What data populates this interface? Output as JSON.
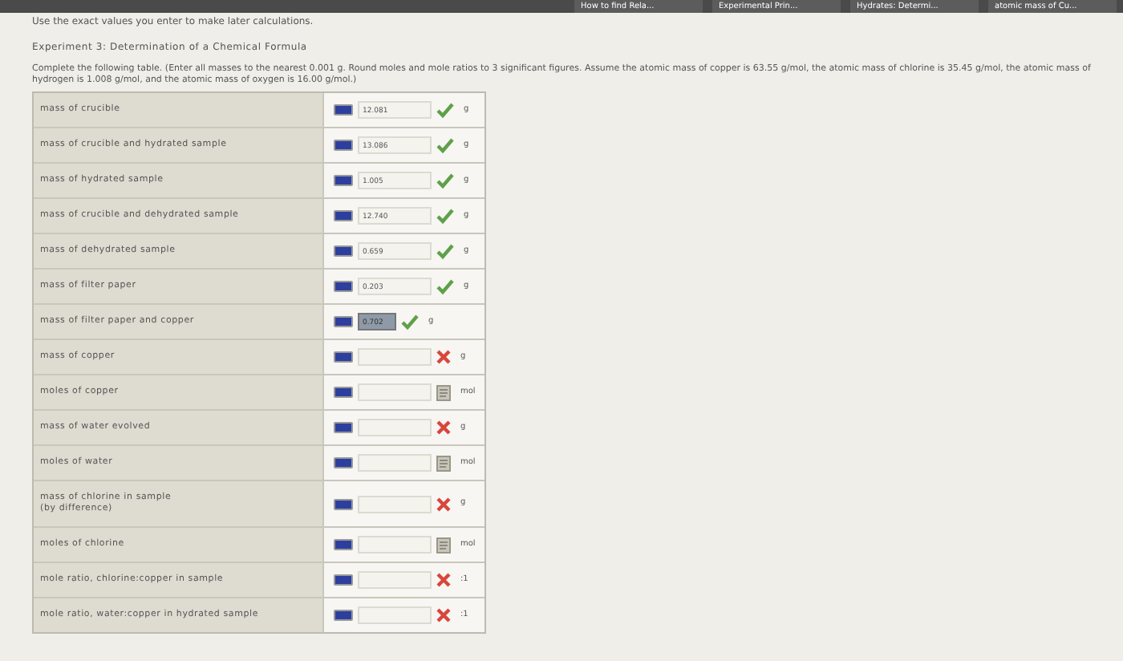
{
  "browser_tabs": [
    {
      "label": "How to find Rela...",
      "selected": false
    },
    {
      "label": "Experimental Prin...",
      "selected": false
    },
    {
      "label": "Hydrates: Determi...",
      "selected": false
    },
    {
      "label": "atomic mass of Cu...",
      "selected": false
    }
  ],
  "note": "Use the exact values you enter to make later calculations.",
  "experiment_title": "Experiment 3: Determination of a Chemical Formula",
  "instructions": "Complete the following table. (Enter all masses to the nearest 0.001 g. Round moles and mole ratios to 3 significant figures. Assume the atomic mass of copper is 63.55 g/mol, the atomic mass of chlorine is 35.45 g/mol, the atomic mass of hydrogen is 1.008 g/mol, and the atomic mass of oxygen is 16.00 g/mol.)",
  "table": {
    "rows": [
      {
        "label": "mass of crucible",
        "value": "12.081",
        "kind": "correct",
        "unit": "g",
        "selected": false
      },
      {
        "label": "mass of crucible and hydrated sample",
        "value": "13.086",
        "kind": "correct",
        "unit": "g",
        "selected": false
      },
      {
        "label": "mass of hydrated sample",
        "value": "1.005",
        "kind": "correct",
        "unit": "g",
        "selected": false
      },
      {
        "label": "mass of crucible and dehydrated sample",
        "value": "12.740",
        "kind": "correct",
        "unit": "g",
        "selected": false
      },
      {
        "label": "mass of dehydrated sample",
        "value": "0.659",
        "kind": "correct",
        "unit": "g",
        "selected": false
      },
      {
        "label": "mass of filter paper",
        "value": "0.203",
        "kind": "correct",
        "unit": "g",
        "selected": false
      },
      {
        "label": "mass of filter paper and copper",
        "value": "0.702",
        "kind": "correct",
        "unit": "g",
        "selected": true
      },
      {
        "label": "mass of copper",
        "kind": "incorrect",
        "unit": "g",
        "selected": false
      },
      {
        "label": "moles of copper",
        "kind": "pending",
        "unit": "mol",
        "selected": false
      },
      {
        "label": "mass of water evolved",
        "kind": "incorrect",
        "unit": "g",
        "selected": false
      },
      {
        "label": "moles of water",
        "kind": "pending",
        "unit": "mol",
        "selected": false
      },
      {
        "label": "mass of chlorine in sample\n(by difference)",
        "kind": "incorrect",
        "unit": "g",
        "selected": false
      },
      {
        "label": "moles of chlorine",
        "kind": "pending",
        "unit": "mol",
        "selected": false
      },
      {
        "label": "mole ratio, chlorine:copper in sample",
        "kind": "incorrect",
        "unit": ":1",
        "selected": false
      },
      {
        "label": "mole ratio, water:copper in hydrated sample",
        "kind": "incorrect",
        "unit": ":1",
        "selected": false
      }
    ]
  }
}
